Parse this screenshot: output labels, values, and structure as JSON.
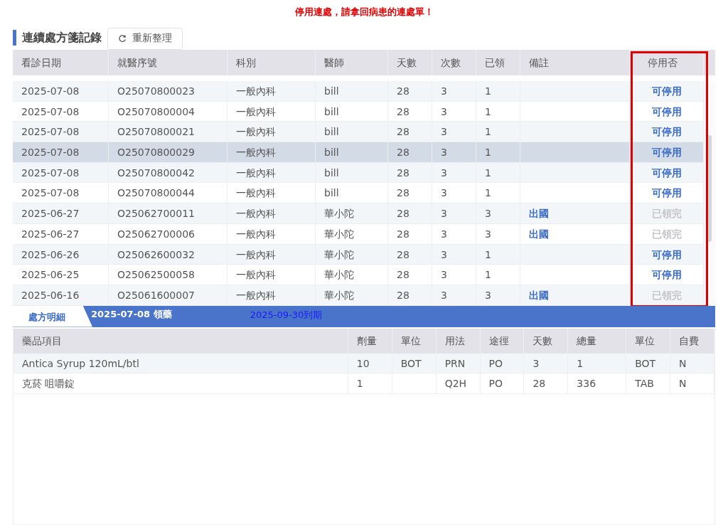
{
  "alert": "停用連處，請拿回病患的連處單！",
  "section": {
    "title": "連續處方箋記錄",
    "refresh_button": "重新整理"
  },
  "records": {
    "columns": [
      "看診日期",
      "就醫序號",
      "科別",
      "醫師",
      "天數",
      "次數",
      "已領",
      "備註",
      "停用否"
    ],
    "rows": [
      {
        "cells": [
          "2025-07-08",
          "O25070800023",
          "一般內科",
          "bill",
          "28",
          "3",
          "1"
        ],
        "note": "",
        "status": {
          "text": "可停用",
          "disabled": false
        },
        "selected": false
      },
      {
        "cells": [
          "2025-07-08",
          "O25070800004",
          "一般內科",
          "bill",
          "28",
          "3",
          "1"
        ],
        "note": "",
        "status": {
          "text": "可停用",
          "disabled": false
        },
        "selected": false
      },
      {
        "cells": [
          "2025-07-08",
          "O25070800021",
          "一般內科",
          "bill",
          "28",
          "3",
          "1"
        ],
        "note": "",
        "status": {
          "text": "可停用",
          "disabled": false
        },
        "selected": false
      },
      {
        "cells": [
          "2025-07-08",
          "O25070800029",
          "一般內科",
          "bill",
          "28",
          "3",
          "1"
        ],
        "note": "",
        "status": {
          "text": "可停用",
          "disabled": false
        },
        "selected": true
      },
      {
        "cells": [
          "2025-07-08",
          "O25070800042",
          "一般內科",
          "bill",
          "28",
          "3",
          "1"
        ],
        "note": "",
        "status": {
          "text": "可停用",
          "disabled": false
        },
        "selected": false
      },
      {
        "cells": [
          "2025-07-08",
          "O25070800044",
          "一般內科",
          "bill",
          "28",
          "3",
          "1"
        ],
        "note": "",
        "status": {
          "text": "可停用",
          "disabled": false
        },
        "selected": false
      },
      {
        "cells": [
          "2025-06-27",
          "O25062700011",
          "一般內科",
          "華小陀",
          "28",
          "3",
          "3"
        ],
        "note": "出國",
        "status": {
          "text": "已領完",
          "disabled": true
        },
        "selected": false
      },
      {
        "cells": [
          "2025-06-27",
          "O25062700006",
          "一般內科",
          "華小陀",
          "28",
          "3",
          "3"
        ],
        "note": "出國",
        "status": {
          "text": "已領完",
          "disabled": true
        },
        "selected": false
      },
      {
        "cells": [
          "2025-06-26",
          "O25062600032",
          "一般內科",
          "華小陀",
          "28",
          "3",
          "1"
        ],
        "note": "",
        "status": {
          "text": "可停用",
          "disabled": false
        },
        "selected": false
      },
      {
        "cells": [
          "2025-06-25",
          "O25062500058",
          "一般內科",
          "華小陀",
          "28",
          "3",
          "1"
        ],
        "note": "",
        "status": {
          "text": "可停用",
          "disabled": false
        },
        "selected": false
      },
      {
        "cells": [
          "2025-06-16",
          "O25061600007",
          "一般內科",
          "華小陀",
          "28",
          "3",
          "3"
        ],
        "note": "出國",
        "status": {
          "text": "已領完",
          "disabled": true
        },
        "selected": false
      }
    ]
  },
  "detail_tabs": [
    {
      "label": "處方明細",
      "selected": true
    }
  ],
  "detail_banner": {
    "pickup": "2025-07-08 領藥",
    "expiry": "2025-09-30到期"
  },
  "detail": {
    "columns": [
      "藥品項目",
      "劑量",
      "單位",
      "用法",
      "途徑",
      "天數",
      "總量",
      "單位",
      "自費"
    ],
    "rows": [
      [
        "Antica Syrup 120mL/btl",
        "10",
        "BOT",
        "PRN",
        "PO",
        "3",
        "1",
        "BOT",
        "N"
      ],
      [
        "克菸 咀嚼錠",
        "1",
        "",
        "Q2H",
        "PO",
        "28",
        "336",
        "TAB",
        "N"
      ]
    ]
  }
}
